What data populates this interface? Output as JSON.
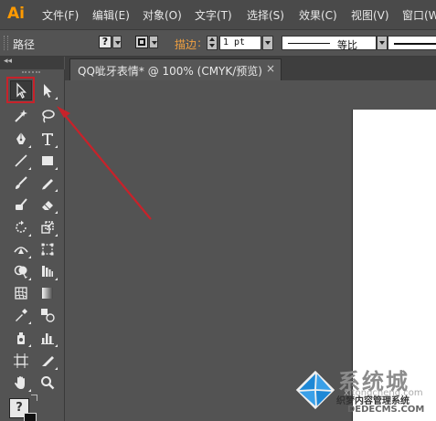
{
  "app": {
    "logo_text": "Ai",
    "logo_color": "#ff9a00"
  },
  "menu": {
    "items": [
      {
        "label": "文件(F)"
      },
      {
        "label": "编辑(E)"
      },
      {
        "label": "对象(O)"
      },
      {
        "label": "文字(T)"
      },
      {
        "label": "选择(S)"
      },
      {
        "label": "效果(C)"
      },
      {
        "label": "视图(V)"
      },
      {
        "label": "窗口(W"
      }
    ]
  },
  "control_bar": {
    "selection_label": "路径",
    "fill_swatch": "?",
    "stroke_label": "描边",
    "stroke_label_color": "#f0a040",
    "stroke_weight": "1 pt",
    "profile_label": "等比"
  },
  "document": {
    "tab_title": "QQ呲牙表情* @ 100% (CMYK/预览)",
    "close_glyph": "×"
  },
  "toolbox": {
    "collapse_glyph": "◂◂",
    "selected_tool": "selection-tool",
    "highlight_color": "#c8222a",
    "tools": [
      {
        "name": "selection-tool-icon"
      },
      {
        "name": "direct-selection-tool-icon"
      },
      {
        "name": "magic-wand-tool-icon"
      },
      {
        "name": "lasso-tool-icon"
      },
      {
        "name": "pen-tool-icon"
      },
      {
        "name": "type-tool-icon"
      },
      {
        "name": "line-segment-tool-icon"
      },
      {
        "name": "rectangle-tool-icon"
      },
      {
        "name": "paintbrush-tool-icon"
      },
      {
        "name": "pencil-tool-icon"
      },
      {
        "name": "blob-brush-tool-icon"
      },
      {
        "name": "eraser-tool-icon"
      },
      {
        "name": "rotate-tool-icon"
      },
      {
        "name": "scale-tool-icon"
      },
      {
        "name": "width-tool-icon"
      },
      {
        "name": "free-transform-tool-icon"
      },
      {
        "name": "shape-builder-tool-icon"
      },
      {
        "name": "perspective-grid-tool-icon"
      },
      {
        "name": "mesh-tool-icon"
      },
      {
        "name": "gradient-tool-icon"
      },
      {
        "name": "eyedropper-tool-icon"
      },
      {
        "name": "blend-tool-icon"
      },
      {
        "name": "symbol-sprayer-tool-icon"
      },
      {
        "name": "column-graph-tool-icon"
      },
      {
        "name": "artboard-tool-icon"
      },
      {
        "name": "slice-tool-icon"
      },
      {
        "name": "hand-tool-icon"
      },
      {
        "name": "zoom-tool-icon"
      }
    ],
    "fill_stroke_glyph": "?"
  },
  "watermark": {
    "title": "系统城",
    "subtitle": "织梦内容管理系统",
    "url": "DEDECMS.COM",
    "url2": "xitongcheng.com"
  }
}
